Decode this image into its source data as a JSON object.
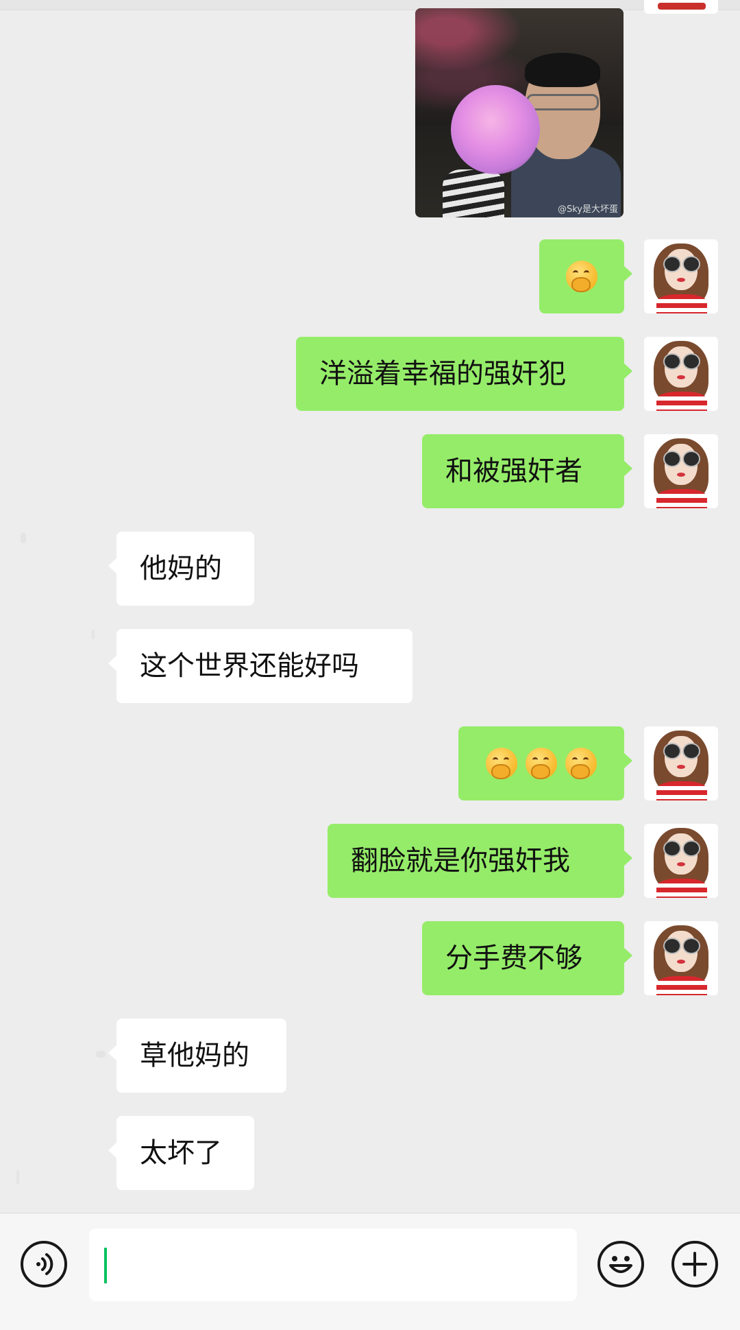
{
  "photo": {
    "watermark": "@Sky是大坏蛋"
  },
  "messages": [
    {
      "side": "out",
      "text": "",
      "emoji_count": 1
    },
    {
      "side": "out",
      "text": "洋溢着幸福的强奸犯"
    },
    {
      "side": "out",
      "text": "和被强奸者"
    },
    {
      "side": "in",
      "text": "他妈的"
    },
    {
      "side": "in",
      "text": "这个世界还能好吗"
    },
    {
      "side": "out",
      "text": "",
      "emoji_count": 3
    },
    {
      "side": "out",
      "text": "翻脸就是你强奸我"
    },
    {
      "side": "out",
      "text": "分手费不够"
    },
    {
      "side": "in",
      "text": "草他妈的"
    },
    {
      "side": "in",
      "text": "太坏了"
    }
  ],
  "emoji_icon": "face-with-hand-over-mouth",
  "colors": {
    "out_bubble": "#95ec69",
    "in_bubble": "#ffffff",
    "background": "#ededed",
    "cursor": "#07c160"
  },
  "input_bar": {
    "value": "",
    "icons": [
      "voice-icon",
      "emoji-icon",
      "plus-icon"
    ]
  }
}
